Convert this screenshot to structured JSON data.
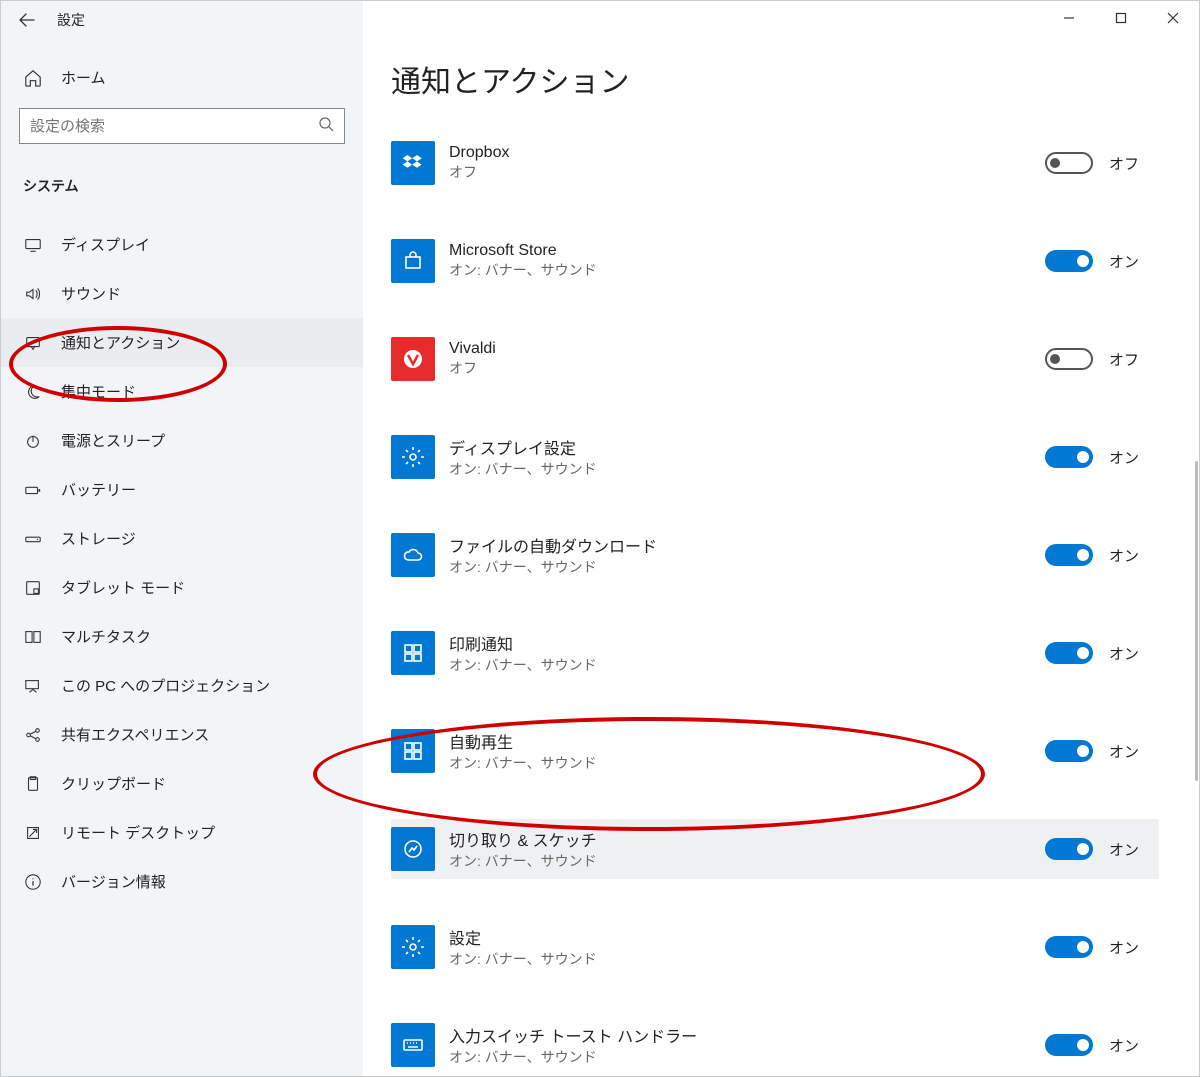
{
  "window": {
    "title": "設定"
  },
  "sidebar": {
    "home": "ホーム",
    "search_placeholder": "設定の検索",
    "section": "システム",
    "items": [
      {
        "label": "ディスプレイ"
      },
      {
        "label": "サウンド"
      },
      {
        "label": "通知とアクション"
      },
      {
        "label": "集中モード"
      },
      {
        "label": "電源とスリープ"
      },
      {
        "label": "バッテリー"
      },
      {
        "label": "ストレージ"
      },
      {
        "label": "タブレット モード"
      },
      {
        "label": "マルチタスク"
      },
      {
        "label": "この PC へのプロジェクション"
      },
      {
        "label": "共有エクスペリエンス"
      },
      {
        "label": "クリップボード"
      },
      {
        "label": "リモート デスクトップ"
      },
      {
        "label": "バージョン情報"
      }
    ]
  },
  "page": {
    "title": "通知とアクション"
  },
  "toggle_labels": {
    "on": "オン",
    "off": "オフ"
  },
  "sub_on": "オン: バナー、サウンド",
  "apps": [
    {
      "label": "Dropbox",
      "sub": "オフ",
      "on": false,
      "icon": "dropbox",
      "bg": "blue"
    },
    {
      "label": "Microsoft Store",
      "sub": "オン: バナー、サウンド",
      "on": true,
      "icon": "store",
      "bg": "blue"
    },
    {
      "label": "Vivaldi",
      "sub": "オフ",
      "on": false,
      "icon": "vivaldi",
      "bg": "red"
    },
    {
      "label": "ディスプレイ設定",
      "sub": "オン: バナー、サウンド",
      "on": true,
      "icon": "gear",
      "bg": "blue"
    },
    {
      "label": "ファイルの自動ダウンロード",
      "sub": "オン: バナー、サウンド",
      "on": true,
      "icon": "cloud",
      "bg": "blue"
    },
    {
      "label": "印刷通知",
      "sub": "オン: バナー、サウンド",
      "on": true,
      "icon": "tiles",
      "bg": "blue"
    },
    {
      "label": "自動再生",
      "sub": "オン: バナー、サウンド",
      "on": true,
      "icon": "tiles",
      "bg": "blue"
    },
    {
      "label": "切り取り & スケッチ",
      "sub": "オン: バナー、サウンド",
      "on": true,
      "icon": "snip",
      "bg": "blue",
      "hl": true
    },
    {
      "label": "設定",
      "sub": "オン: バナー、サウンド",
      "on": true,
      "icon": "gear",
      "bg": "blue"
    },
    {
      "label": "入力スイッチ トースト ハンドラー",
      "sub": "オン: バナー、サウンド",
      "on": true,
      "icon": "keyboard",
      "bg": "blue"
    }
  ]
}
